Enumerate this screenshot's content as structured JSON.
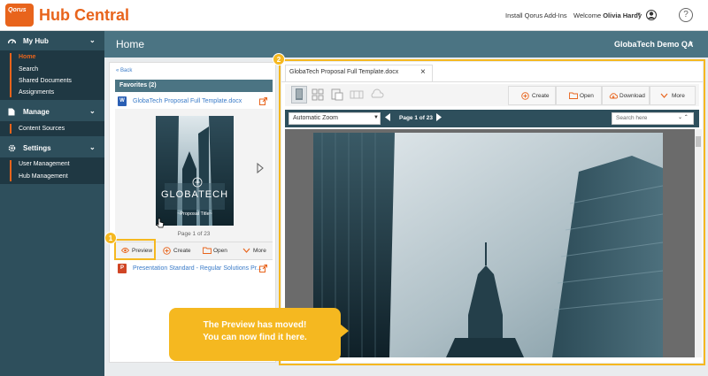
{
  "app": {
    "logo_text": "Qorus",
    "title": "Hub Central"
  },
  "topbar": {
    "install_link": "Install Qorus Add-Ins",
    "welcome_prefix": "Welcome",
    "user_name": "Olivia Hardy",
    "help_label": "?"
  },
  "sidebar": {
    "sections": [
      {
        "label": "My Hub",
        "icon": "dashboard-icon",
        "items": [
          {
            "label": "Home",
            "active": true
          },
          {
            "label": "Search"
          },
          {
            "label": "Shared Documents"
          },
          {
            "label": "Assignments"
          }
        ]
      },
      {
        "label": "Manage",
        "icon": "document-icon",
        "items": [
          {
            "label": "Content Sources"
          }
        ]
      },
      {
        "label": "Settings",
        "icon": "gear-icon",
        "items": [
          {
            "label": "User Management"
          },
          {
            "label": "Hub Management"
          }
        ]
      }
    ]
  },
  "header": {
    "title": "Home",
    "environment": "GlobaTech Demo QA"
  },
  "favorites": {
    "back_label": "« Back",
    "title": "Favorites (2)",
    "items": [
      {
        "name": "GlobaTech Proposal Full Template.docx",
        "type": "word",
        "icon_letter": "W"
      },
      {
        "name": "Presentation Standard - Regular Solutions Pr...",
        "type": "powerpoint",
        "icon_letter": "P"
      }
    ],
    "thumbnail": {
      "brand": "GLOBATECH",
      "subtitle": "~Proposal Title~",
      "page_label": "Page 1 of 23"
    },
    "actions": [
      {
        "label": "Preview",
        "icon": "eye-icon"
      },
      {
        "label": "Create",
        "icon": "plus-circle-icon"
      },
      {
        "label": "Open",
        "icon": "folder-icon"
      },
      {
        "label": "More",
        "icon": "chevron-down-icon"
      }
    ]
  },
  "preview": {
    "tab_label": "GlobaTech Proposal Full Template.docx",
    "close_label": "×",
    "toolbar": [
      {
        "label": "Create",
        "icon": "plus-circle-icon"
      },
      {
        "label": "Open",
        "icon": "folder-icon"
      },
      {
        "label": "Download",
        "icon": "cloud-download-icon"
      },
      {
        "label": "More",
        "icon": "chevron-down-icon"
      }
    ],
    "view_icons": [
      "single-page-icon",
      "grid-view-icon",
      "gallery-icon",
      "film-strip-icon",
      "cloud-icon"
    ],
    "zoom": "Automatic Zoom",
    "page_indicator": "Page 1 of 23",
    "search_placeholder": "Search here"
  },
  "badges": {
    "one": "1",
    "two": "2"
  },
  "callout": {
    "line1": "The Preview has moved!",
    "line2": "You can now find it here."
  },
  "colors": {
    "accent": "#e8641c",
    "sidebar": "#2e4f5c",
    "header": "#4b7483",
    "highlight": "#f5b820"
  }
}
